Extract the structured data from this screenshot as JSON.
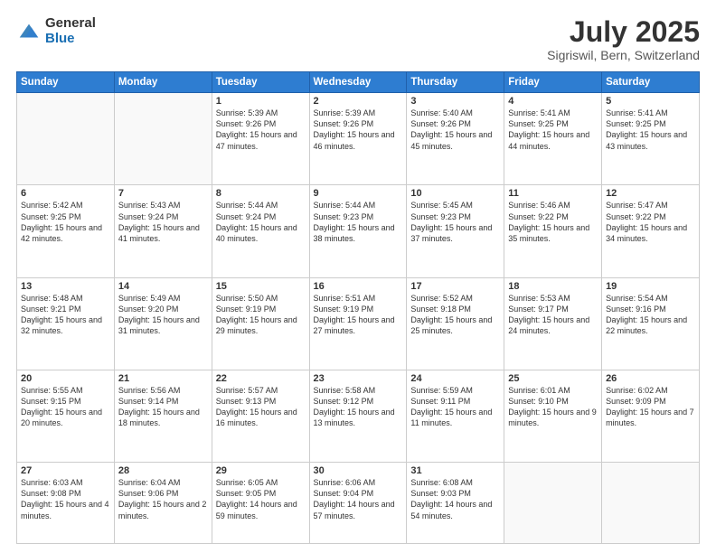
{
  "logo": {
    "general": "General",
    "blue": "Blue"
  },
  "header": {
    "month": "July 2025",
    "location": "Sigriswil, Bern, Switzerland"
  },
  "days_of_week": [
    "Sunday",
    "Monday",
    "Tuesday",
    "Wednesday",
    "Thursday",
    "Friday",
    "Saturday"
  ],
  "weeks": [
    [
      {
        "day": "",
        "sunrise": "",
        "sunset": "",
        "daylight": ""
      },
      {
        "day": "",
        "sunrise": "",
        "sunset": "",
        "daylight": ""
      },
      {
        "day": "1",
        "sunrise": "Sunrise: 5:39 AM",
        "sunset": "Sunset: 9:26 PM",
        "daylight": "Daylight: 15 hours and 47 minutes."
      },
      {
        "day": "2",
        "sunrise": "Sunrise: 5:39 AM",
        "sunset": "Sunset: 9:26 PM",
        "daylight": "Daylight: 15 hours and 46 minutes."
      },
      {
        "day": "3",
        "sunrise": "Sunrise: 5:40 AM",
        "sunset": "Sunset: 9:26 PM",
        "daylight": "Daylight: 15 hours and 45 minutes."
      },
      {
        "day": "4",
        "sunrise": "Sunrise: 5:41 AM",
        "sunset": "Sunset: 9:25 PM",
        "daylight": "Daylight: 15 hours and 44 minutes."
      },
      {
        "day": "5",
        "sunrise": "Sunrise: 5:41 AM",
        "sunset": "Sunset: 9:25 PM",
        "daylight": "Daylight: 15 hours and 43 minutes."
      }
    ],
    [
      {
        "day": "6",
        "sunrise": "Sunrise: 5:42 AM",
        "sunset": "Sunset: 9:25 PM",
        "daylight": "Daylight: 15 hours and 42 minutes."
      },
      {
        "day": "7",
        "sunrise": "Sunrise: 5:43 AM",
        "sunset": "Sunset: 9:24 PM",
        "daylight": "Daylight: 15 hours and 41 minutes."
      },
      {
        "day": "8",
        "sunrise": "Sunrise: 5:44 AM",
        "sunset": "Sunset: 9:24 PM",
        "daylight": "Daylight: 15 hours and 40 minutes."
      },
      {
        "day": "9",
        "sunrise": "Sunrise: 5:44 AM",
        "sunset": "Sunset: 9:23 PM",
        "daylight": "Daylight: 15 hours and 38 minutes."
      },
      {
        "day": "10",
        "sunrise": "Sunrise: 5:45 AM",
        "sunset": "Sunset: 9:23 PM",
        "daylight": "Daylight: 15 hours and 37 minutes."
      },
      {
        "day": "11",
        "sunrise": "Sunrise: 5:46 AM",
        "sunset": "Sunset: 9:22 PM",
        "daylight": "Daylight: 15 hours and 35 minutes."
      },
      {
        "day": "12",
        "sunrise": "Sunrise: 5:47 AM",
        "sunset": "Sunset: 9:22 PM",
        "daylight": "Daylight: 15 hours and 34 minutes."
      }
    ],
    [
      {
        "day": "13",
        "sunrise": "Sunrise: 5:48 AM",
        "sunset": "Sunset: 9:21 PM",
        "daylight": "Daylight: 15 hours and 32 minutes."
      },
      {
        "day": "14",
        "sunrise": "Sunrise: 5:49 AM",
        "sunset": "Sunset: 9:20 PM",
        "daylight": "Daylight: 15 hours and 31 minutes."
      },
      {
        "day": "15",
        "sunrise": "Sunrise: 5:50 AM",
        "sunset": "Sunset: 9:19 PM",
        "daylight": "Daylight: 15 hours and 29 minutes."
      },
      {
        "day": "16",
        "sunrise": "Sunrise: 5:51 AM",
        "sunset": "Sunset: 9:19 PM",
        "daylight": "Daylight: 15 hours and 27 minutes."
      },
      {
        "day": "17",
        "sunrise": "Sunrise: 5:52 AM",
        "sunset": "Sunset: 9:18 PM",
        "daylight": "Daylight: 15 hours and 25 minutes."
      },
      {
        "day": "18",
        "sunrise": "Sunrise: 5:53 AM",
        "sunset": "Sunset: 9:17 PM",
        "daylight": "Daylight: 15 hours and 24 minutes."
      },
      {
        "day": "19",
        "sunrise": "Sunrise: 5:54 AM",
        "sunset": "Sunset: 9:16 PM",
        "daylight": "Daylight: 15 hours and 22 minutes."
      }
    ],
    [
      {
        "day": "20",
        "sunrise": "Sunrise: 5:55 AM",
        "sunset": "Sunset: 9:15 PM",
        "daylight": "Daylight: 15 hours and 20 minutes."
      },
      {
        "day": "21",
        "sunrise": "Sunrise: 5:56 AM",
        "sunset": "Sunset: 9:14 PM",
        "daylight": "Daylight: 15 hours and 18 minutes."
      },
      {
        "day": "22",
        "sunrise": "Sunrise: 5:57 AM",
        "sunset": "Sunset: 9:13 PM",
        "daylight": "Daylight: 15 hours and 16 minutes."
      },
      {
        "day": "23",
        "sunrise": "Sunrise: 5:58 AM",
        "sunset": "Sunset: 9:12 PM",
        "daylight": "Daylight: 15 hours and 13 minutes."
      },
      {
        "day": "24",
        "sunrise": "Sunrise: 5:59 AM",
        "sunset": "Sunset: 9:11 PM",
        "daylight": "Daylight: 15 hours and 11 minutes."
      },
      {
        "day": "25",
        "sunrise": "Sunrise: 6:01 AM",
        "sunset": "Sunset: 9:10 PM",
        "daylight": "Daylight: 15 hours and 9 minutes."
      },
      {
        "day": "26",
        "sunrise": "Sunrise: 6:02 AM",
        "sunset": "Sunset: 9:09 PM",
        "daylight": "Daylight: 15 hours and 7 minutes."
      }
    ],
    [
      {
        "day": "27",
        "sunrise": "Sunrise: 6:03 AM",
        "sunset": "Sunset: 9:08 PM",
        "daylight": "Daylight: 15 hours and 4 minutes."
      },
      {
        "day": "28",
        "sunrise": "Sunrise: 6:04 AM",
        "sunset": "Sunset: 9:06 PM",
        "daylight": "Daylight: 15 hours and 2 minutes."
      },
      {
        "day": "29",
        "sunrise": "Sunrise: 6:05 AM",
        "sunset": "Sunset: 9:05 PM",
        "daylight": "Daylight: 14 hours and 59 minutes."
      },
      {
        "day": "30",
        "sunrise": "Sunrise: 6:06 AM",
        "sunset": "Sunset: 9:04 PM",
        "daylight": "Daylight: 14 hours and 57 minutes."
      },
      {
        "day": "31",
        "sunrise": "Sunrise: 6:08 AM",
        "sunset": "Sunset: 9:03 PM",
        "daylight": "Daylight: 14 hours and 54 minutes."
      },
      {
        "day": "",
        "sunrise": "",
        "sunset": "",
        "daylight": ""
      },
      {
        "day": "",
        "sunrise": "",
        "sunset": "",
        "daylight": ""
      }
    ]
  ]
}
